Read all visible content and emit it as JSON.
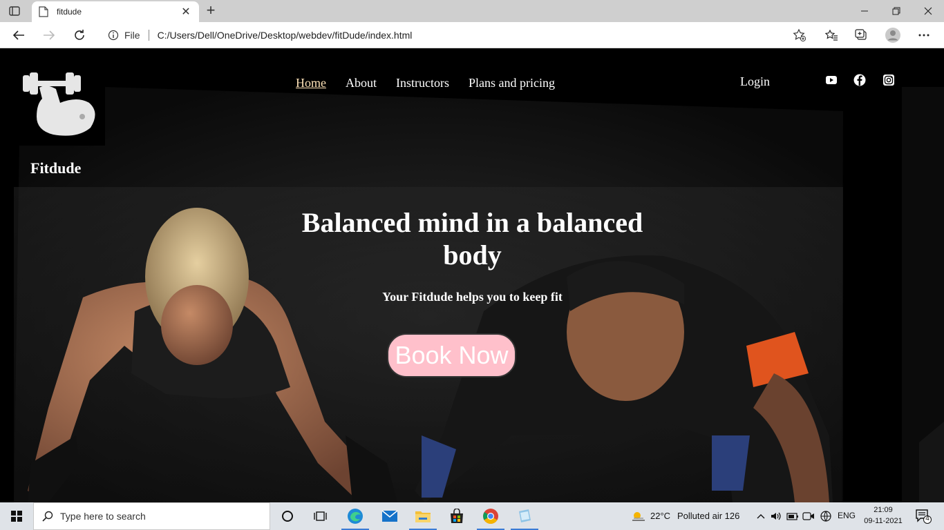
{
  "browser": {
    "tab_title": "fitdude",
    "protocol_label": "File",
    "url": "C:/Users/Dell/OneDrive/Desktop/webdev/fitDude/index.html"
  },
  "site": {
    "brand": "Fitdude",
    "nav": [
      "Home",
      "About",
      "Instructors",
      "Plans and pricing"
    ],
    "active_nav": "Home",
    "login": "Login",
    "social": [
      "youtube-icon",
      "facebook-icon",
      "instagram-icon"
    ]
  },
  "hero": {
    "title": "Balanced mind in a balanced body",
    "subtitle": "Your Fitdude helps you to keep fit",
    "cta": "Book Now",
    "cta_color": "#ffc0cb"
  },
  "taskbar": {
    "search_placeholder": "Type here to search",
    "weather_temp": "22°C",
    "weather_text": "Polluted air 126",
    "language": "ENG",
    "time": "21:09",
    "date": "09-11-2021",
    "notification_count": "4"
  }
}
